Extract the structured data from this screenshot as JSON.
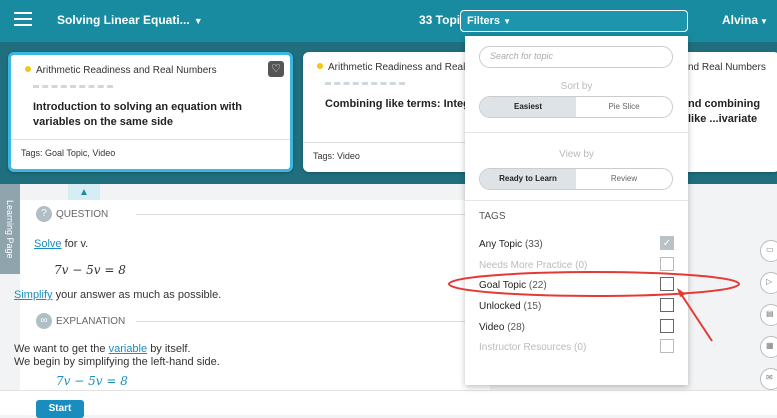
{
  "header": {
    "course_title": "Solving Linear Equati...",
    "topics_count": "33 Topics",
    "filters_label": "Filters",
    "user_name": "Alvina"
  },
  "cards": [
    {
      "category": "Arithmetic Readiness and Real Numbers",
      "title": "Introduction to solving an equation with variables on the same side",
      "tags": "Tags: Goal Topic, Video"
    },
    {
      "category": "Arithmetic Readiness and Real Nu",
      "title": "Combining like terms: Integer",
      "tags": "Tags: Video"
    },
    {
      "category": "nd Real Numbers",
      "title": "nd combining like ...ivariate",
      "tags": ""
    }
  ],
  "side_label": "Learning Page",
  "question": {
    "section_label": "QUESTION",
    "solve_link": "Solve",
    "solve_text": "for v.",
    "equation": "7v − 5v = 8",
    "simplify_link": "Simplify",
    "simplify_text": "your answer as much as possible."
  },
  "explanation": {
    "section_label": "EXPLANATION",
    "line1_pre": "We want to get the",
    "line1_link": "variable",
    "line1_post": "by itself.",
    "line2": "We begin by simplifying the left-hand side.",
    "equation": "7v − 5v = 8"
  },
  "footer": {
    "start_label": "Start"
  },
  "filters": {
    "search_placeholder": "Search for topic",
    "sort_by_label": "Sort by",
    "sort_options": [
      "Easiest",
      "Pie Slice"
    ],
    "view_by_label": "View by",
    "view_options": [
      "Ready to Learn",
      "Review"
    ],
    "tags_title": "TAGS",
    "tags": [
      {
        "label": "Any Topic",
        "count": "(33)",
        "checked": true,
        "dim": false
      },
      {
        "label": "Needs More Practice",
        "count": "(0)",
        "checked": false,
        "dim": true
      },
      {
        "label": "Goal Topic",
        "count": "(22)",
        "checked": false,
        "dim": false
      },
      {
        "label": "Unlocked",
        "count": "(15)",
        "checked": false,
        "dim": false
      },
      {
        "label": "Video",
        "count": "(28)",
        "checked": false,
        "dim": false
      },
      {
        "label": "Instructor Resources",
        "count": "(0)",
        "checked": false,
        "dim": true
      }
    ]
  },
  "colors": {
    "header": "#188ba1",
    "accent": "#1a8dbf",
    "annotation": "#e53935"
  }
}
